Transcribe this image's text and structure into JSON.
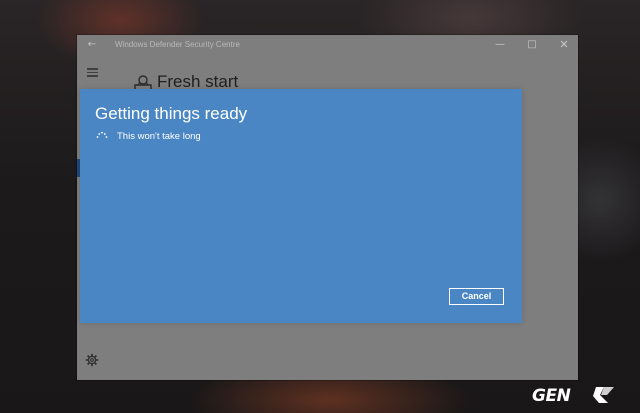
{
  "window": {
    "title": "Windows Defender Security Centre",
    "controls": {
      "back_icon": "arrow-left-icon",
      "minimize_icon": "minimize-icon",
      "maximize_icon": "maximize-icon",
      "close_icon": "close-icon"
    }
  },
  "page": {
    "title": "Fresh start",
    "title_icon": "fresh-start-icon",
    "menu_icon": "hamburger-icon",
    "settings_icon": "gear-icon"
  },
  "dialog": {
    "title": "Getting things ready",
    "subtitle": "This won't take long",
    "spinner_icon": "loading-spinner-icon",
    "cancel_label": "Cancel",
    "background_color": "#4a86c4"
  },
  "watermark": {
    "brand": "GENK"
  }
}
